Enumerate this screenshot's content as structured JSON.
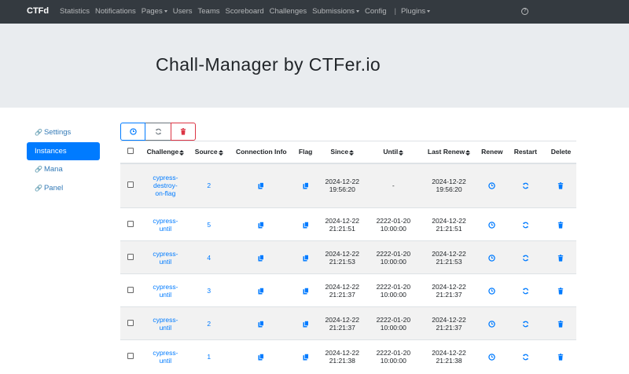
{
  "navbar": {
    "brand": "CTFd",
    "links": [
      {
        "label": "Statistics",
        "dropdown": false
      },
      {
        "label": "Notifications",
        "dropdown": false
      },
      {
        "label": "Pages",
        "dropdown": true
      },
      {
        "label": "Users",
        "dropdown": false
      },
      {
        "label": "Teams",
        "dropdown": false
      },
      {
        "label": "Scoreboard",
        "dropdown": false
      },
      {
        "label": "Challenges",
        "dropdown": false
      },
      {
        "label": "Submissions",
        "dropdown": true
      },
      {
        "label": "Config",
        "dropdown": false
      }
    ],
    "separator": "|",
    "plugins_label": "Plugins",
    "help_icon": "question-circle-icon"
  },
  "header": {
    "title": "Chall-Manager by CTFer.io"
  },
  "sidebar": {
    "items": [
      {
        "label": "Settings",
        "icon": "link-icon",
        "active": false
      },
      {
        "label": "Instances",
        "icon": "",
        "active": true
      },
      {
        "label": "Mana",
        "icon": "link-icon",
        "active": false
      },
      {
        "label": "Panel",
        "icon": "link-icon",
        "active": false
      }
    ]
  },
  "actions": {
    "renew_icon": "clock-icon",
    "restart_icon": "sync-icon",
    "delete_icon": "trash-icon"
  },
  "table": {
    "columns": [
      "Challenge",
      "Source",
      "Connection Info",
      "Flag",
      "Since",
      "Until",
      "Last Renew",
      "Renew",
      "Restart",
      "Delete"
    ],
    "rows": [
      {
        "challenge": "cypress-destroy-on-flag",
        "challenge_lines": [
          "cypress-",
          "destroy-",
          "on-flag"
        ],
        "source": "2",
        "since": [
          "2024-12-22",
          "19:56:20"
        ],
        "until": [
          "-"
        ],
        "last_renew": [
          "2024-12-22",
          "19:56:20"
        ]
      },
      {
        "challenge": "cypress-until",
        "challenge_lines": [
          "cypress-",
          "until"
        ],
        "source": "5",
        "since": [
          "2024-12-22",
          "21:21:51"
        ],
        "until": [
          "2222-01-20",
          "10:00:00"
        ],
        "last_renew": [
          "2024-12-22",
          "21:21:51"
        ]
      },
      {
        "challenge": "cypress-until",
        "challenge_lines": [
          "cypress-",
          "until"
        ],
        "source": "4",
        "since": [
          "2024-12-22",
          "21:21:53"
        ],
        "until": [
          "2222-01-20",
          "10:00:00"
        ],
        "last_renew": [
          "2024-12-22",
          "21:21:53"
        ]
      },
      {
        "challenge": "cypress-until",
        "challenge_lines": [
          "cypress-",
          "until"
        ],
        "source": "3",
        "since": [
          "2024-12-22",
          "21:21:37"
        ],
        "until": [
          "2222-01-20",
          "10:00:00"
        ],
        "last_renew": [
          "2024-12-22",
          "21:21:37"
        ]
      },
      {
        "challenge": "cypress-until",
        "challenge_lines": [
          "cypress-",
          "until"
        ],
        "source": "2",
        "since": [
          "2024-12-22",
          "21:21:37"
        ],
        "until": [
          "2222-01-20",
          "10:00:00"
        ],
        "last_renew": [
          "2024-12-22",
          "21:21:37"
        ]
      },
      {
        "challenge": "cypress-until",
        "challenge_lines": [
          "cypress-",
          "until"
        ],
        "source": "1",
        "since": [
          "2024-12-22",
          "21:21:38"
        ],
        "until": [
          "2222-01-20",
          "10:00:00"
        ],
        "last_renew": [
          "2024-12-22",
          "21:21:38"
        ]
      }
    ]
  },
  "colors": {
    "navbar_bg": "#343a40",
    "jumbotron_bg": "#e9ecef",
    "primary": "#007bff",
    "danger": "#dc3545",
    "secondary": "#6c757d",
    "stripe": "#f2f2f2"
  }
}
